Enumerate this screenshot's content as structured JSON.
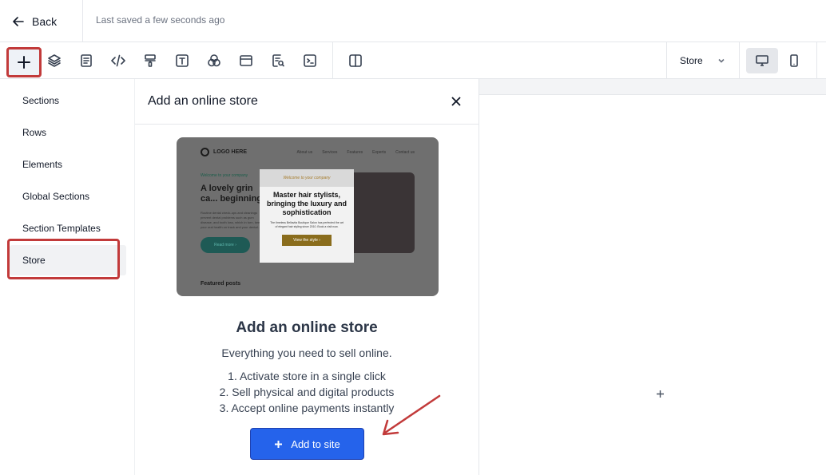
{
  "header": {
    "back_label": "Back",
    "saved_status": "Last saved a few seconds ago"
  },
  "toolbar": {
    "store_select_value": "Store",
    "icons": [
      "plus-icon",
      "layers-icon",
      "page-icon",
      "code-icon",
      "paint-roller-icon",
      "text-icon",
      "shapes-icon",
      "browser-window-icon",
      "search-document-icon",
      "terminal-icon",
      "split-view-icon"
    ]
  },
  "sidebar": {
    "items": [
      {
        "label": "Sections"
      },
      {
        "label": "Rows"
      },
      {
        "label": "Elements"
      },
      {
        "label": "Global Sections"
      },
      {
        "label": "Section Templates"
      },
      {
        "label": "Store"
      }
    ],
    "active": "Store"
  },
  "panel": {
    "title": "Add an online store",
    "preview": {
      "logo": "LOGO HERE",
      "nav": [
        "About us",
        "Services",
        "Features",
        "Experts",
        "Contact us"
      ],
      "welcome": "Welcome to your company",
      "hero": "A lovely grin ca... beginning",
      "body": "Routine dental check-ups and cleanings prevent dental problems such as gum disease, and tooth loss, which in turn, keep your oral health on track and your dental...",
      "read_more": "Read more  ›",
      "featured": "Featured posts",
      "card_tagline": "Welcome to your company",
      "card_heading": "Master hair stylists, bringing the luxury and sophistication",
      "card_body": "The timeless Bellavita Boutique Salon has perfected the art of elegant hair styling since 2010. Book a visit now.",
      "card_button": "View the style  ›"
    },
    "heading": "Add an online store",
    "subheading": "Everything you need to sell online.",
    "steps": [
      "1. Activate store in a single click",
      "2. Sell physical and digital products",
      "3. Accept online payments instantly"
    ],
    "add_button_label": "Add to site"
  },
  "colors": {
    "accent": "#2563eb",
    "highlight_annotation": "#c23a3a"
  }
}
